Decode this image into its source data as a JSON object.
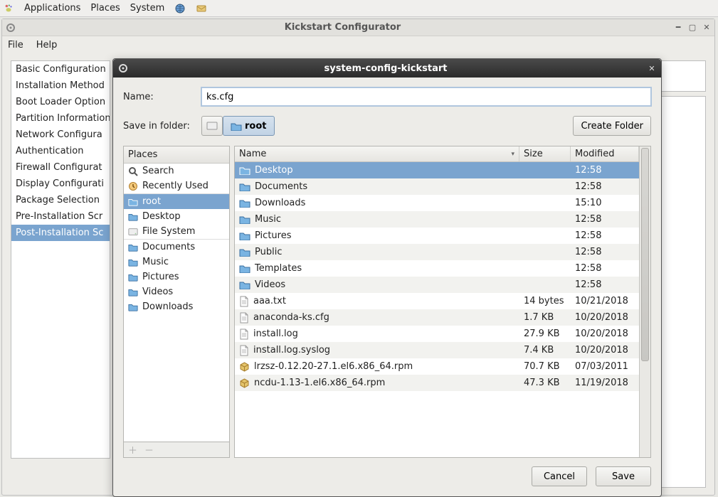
{
  "panel": {
    "menus": [
      "Applications",
      "Places",
      "System"
    ]
  },
  "main_window": {
    "title": "Kickstart Configurator",
    "menubar": [
      "File",
      "Help"
    ],
    "sidebar_items": [
      "Basic Configuration",
      "Installation Method",
      "Boot Loader Option",
      "Partition Information",
      "Network Configura",
      "Authentication",
      "Firewall Configurat",
      "Display Configurati",
      "Package Selection",
      "Pre-Installation Scr",
      "Post-Installation Sc"
    ],
    "sidebar_selected_index": 10
  },
  "dialog": {
    "title": "system-config-kickstart",
    "name_label": "Name:",
    "name_value": "ks.cfg",
    "save_in_label": "Save in folder:",
    "path_segments": [
      "root"
    ],
    "create_folder_label": "Create Folder",
    "places_header": "Places",
    "places": [
      {
        "icon": "search-icon",
        "label": "Search"
      },
      {
        "icon": "recent-icon",
        "label": "Recently Used"
      },
      {
        "icon": "folder-icon",
        "label": "root",
        "selected": true,
        "sep": true
      },
      {
        "icon": "folder-icon",
        "label": "Desktop"
      },
      {
        "icon": "disk-icon",
        "label": "File System"
      },
      {
        "icon": "folder-icon",
        "label": "Documents",
        "sep": true
      },
      {
        "icon": "folder-icon",
        "label": "Music"
      },
      {
        "icon": "folder-icon",
        "label": "Pictures"
      },
      {
        "icon": "folder-icon",
        "label": "Videos"
      },
      {
        "icon": "folder-icon",
        "label": "Downloads"
      }
    ],
    "columns": {
      "name": "Name",
      "size": "Size",
      "modified": "Modified"
    },
    "files": [
      {
        "icon": "folder-icon",
        "name": "Desktop",
        "size": "",
        "modified": "12:58",
        "selected": true
      },
      {
        "icon": "folder-icon",
        "name": "Documents",
        "size": "",
        "modified": "12:58"
      },
      {
        "icon": "folder-icon",
        "name": "Downloads",
        "size": "",
        "modified": "15:10"
      },
      {
        "icon": "folder-icon",
        "name": "Music",
        "size": "",
        "modified": "12:58"
      },
      {
        "icon": "folder-icon",
        "name": "Pictures",
        "size": "",
        "modified": "12:58"
      },
      {
        "icon": "folder-icon",
        "name": "Public",
        "size": "",
        "modified": "12:58"
      },
      {
        "icon": "folder-icon",
        "name": "Templates",
        "size": "",
        "modified": "12:58"
      },
      {
        "icon": "folder-icon",
        "name": "Videos",
        "size": "",
        "modified": "12:58"
      },
      {
        "icon": "file-icon",
        "name": "aaa.txt",
        "size": "14 bytes",
        "modified": "10/21/2018"
      },
      {
        "icon": "file-icon",
        "name": "anaconda-ks.cfg",
        "size": "1.7 KB",
        "modified": "10/20/2018"
      },
      {
        "icon": "file-icon",
        "name": "install.log",
        "size": "27.9 KB",
        "modified": "10/20/2018"
      },
      {
        "icon": "file-icon",
        "name": "install.log.syslog",
        "size": "7.4 KB",
        "modified": "10/20/2018"
      },
      {
        "icon": "package-icon",
        "name": "lrzsz-0.12.20-27.1.el6.x86_64.rpm",
        "size": "70.7 KB",
        "modified": "07/03/2011"
      },
      {
        "icon": "package-icon",
        "name": "ncdu-1.13-1.el6.x86_64.rpm",
        "size": "47.3 KB",
        "modified": "11/19/2018"
      }
    ],
    "buttons": {
      "cancel": "Cancel",
      "save": "Save"
    }
  },
  "colors": {
    "selection": "#7aa4cf"
  }
}
